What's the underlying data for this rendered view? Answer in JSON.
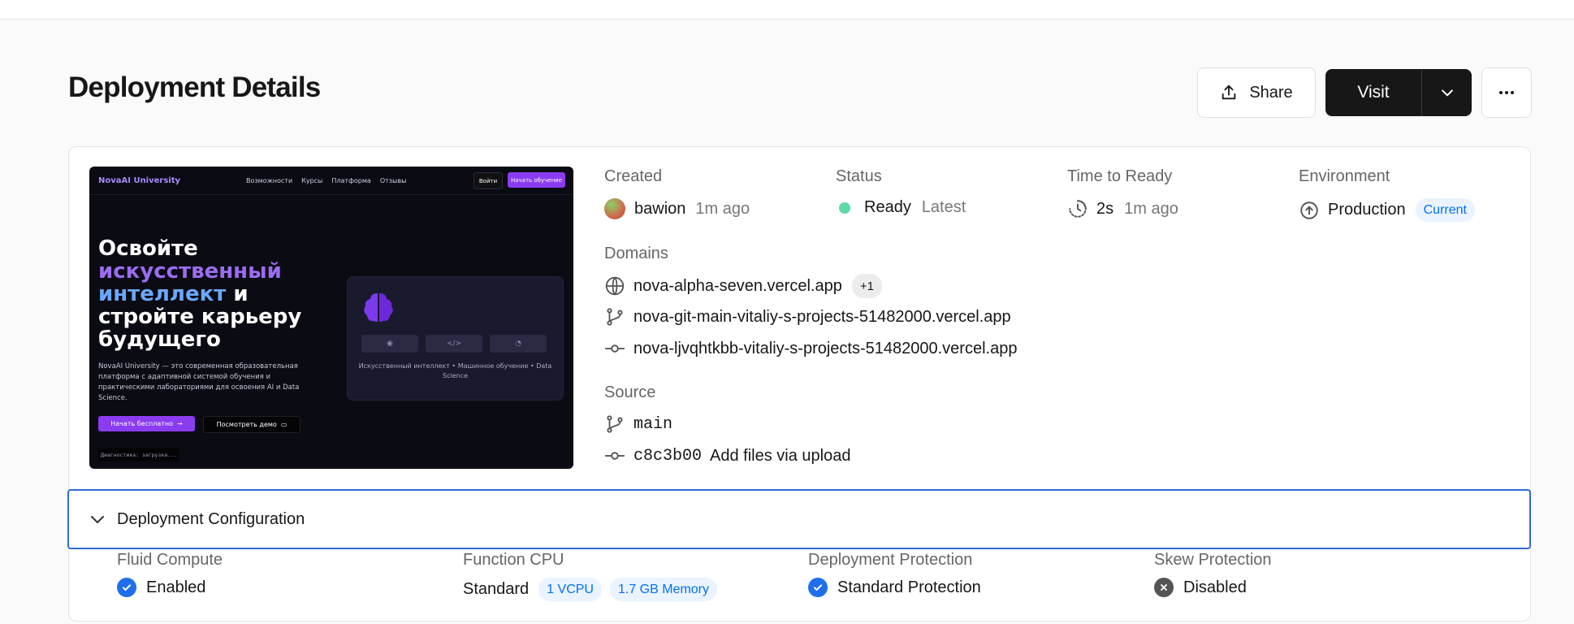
{
  "page": {
    "title": "Deployment Details"
  },
  "actions": {
    "share_label": "Share",
    "visit_label": "Visit"
  },
  "preview": {
    "brand": "NovaAI University",
    "nav_links": [
      "Возможности",
      "Курсы",
      "Платформа",
      "Отзывы"
    ],
    "login_label": "Войти",
    "start_label": "Начать обучение",
    "hero_line1": "Освойте",
    "hero_line2": "искусственный",
    "hero_line3a": "интеллект",
    "hero_line3b": " и",
    "hero_line4": "стройте карьеру",
    "hero_line5": "будущего",
    "description": "NovaAI University — это современная образовательная платформа с адаптивной системой обучения и практическими лабораториями для освоения AI и Data Science.",
    "cta_primary": "Начать бесплатно",
    "cta_secondary": "Посмотреть демо",
    "diagnostics": "Диагностика: загрузка...",
    "panel_caption": "Искусственный интеллект • Машинное обучение • Data Science"
  },
  "meta": {
    "created": {
      "label": "Created",
      "user": "bawion",
      "time": "1m ago"
    },
    "status": {
      "label": "Status",
      "value": "Ready",
      "tag": "Latest",
      "color": "#5fd9a6"
    },
    "time_to_ready": {
      "label": "Time to Ready",
      "value": "2s",
      "time": "1m ago"
    },
    "environment": {
      "label": "Environment",
      "value": "Production",
      "badge": "Current"
    }
  },
  "domains": {
    "label": "Domains",
    "items": [
      {
        "icon": "globe-icon",
        "text": "nova-alpha-seven.vercel.app",
        "extra": "+1"
      },
      {
        "icon": "git-branch-icon",
        "text": "nova-git-main-vitaliy-s-projects-51482000.vercel.app"
      },
      {
        "icon": "git-commit-icon",
        "text": "nova-ljvqhtkbb-vitaliy-s-projects-51482000.vercel.app"
      }
    ]
  },
  "source": {
    "label": "Source",
    "branch": "main",
    "commit_hash": "c8c3b00",
    "commit_message": "Add files via upload"
  },
  "config": {
    "title": "Deployment Configuration",
    "fluid_compute": {
      "label": "Fluid Compute",
      "value": "Enabled"
    },
    "function_cpu": {
      "label": "Function CPU",
      "value": "Standard",
      "badge1": "1 VCPU",
      "badge2": "1.7 GB Memory"
    },
    "deployment_protection": {
      "label": "Deployment Protection",
      "value": "Standard Protection"
    },
    "skew_protection": {
      "label": "Skew Protection",
      "value": "Disabled"
    }
  },
  "colors": {
    "accent": "#0070f3",
    "check": "#1f6feb",
    "focus": "#2f6bd6",
    "preview_purple": "#8b3cf0"
  }
}
